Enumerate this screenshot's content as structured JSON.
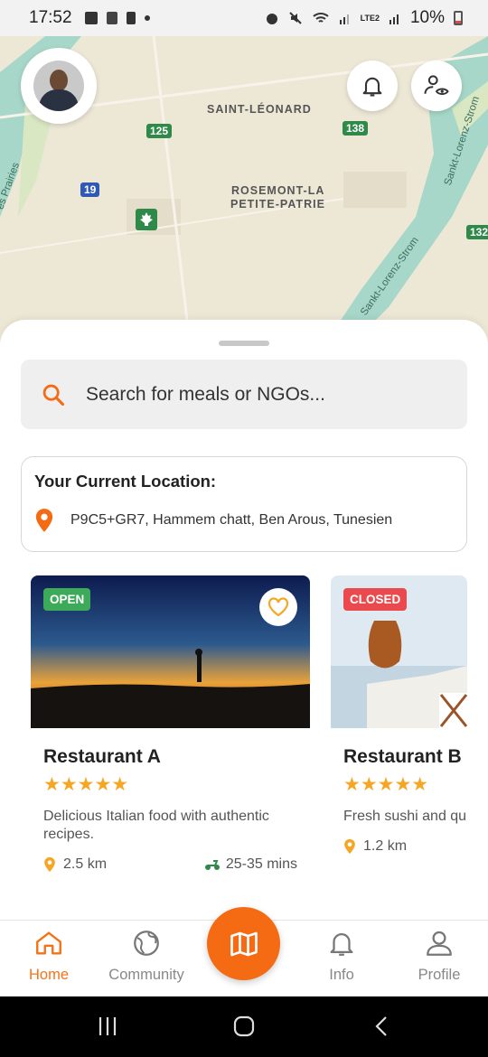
{
  "status_bar": {
    "time": "17:52",
    "battery": "10%",
    "network": "LTE2"
  },
  "map": {
    "labels": [
      "SAINT-LÉONARD",
      "ROSEMONT-LA",
      "PETITE-PATRIE"
    ],
    "shields": [
      "125",
      "138",
      "19",
      "132"
    ],
    "rivers": [
      "Sankt-Lorenz-Strom",
      "Sankt-Lorenz-Strom",
      "es Prairies"
    ],
    "colors": {
      "land": "#ede7d6",
      "water": "#a7d7c8",
      "park": "#d9e7c3"
    }
  },
  "header": {
    "avatar_icon": "user-avatar",
    "notification_icon": "bell-icon",
    "visibility_icon": "user-eye-icon"
  },
  "search": {
    "placeholder": "Search for meals or NGOs...",
    "icon": "search-icon"
  },
  "location": {
    "title": "Your Current Location:",
    "address": "P9C5+GR7, Hammem chatt, Ben Arous, Tunesien",
    "icon": "map-pin-icon"
  },
  "restaurants": [
    {
      "status": "OPEN",
      "name": "Restaurant A",
      "rating": 5,
      "stars": "★★★★★",
      "description": "Delicious Italian food with authentic recipes.",
      "distance": "2.5 km",
      "delivery_time": "25-35 mins"
    },
    {
      "status": "CLOSED",
      "name": "Restaurant B",
      "rating": 5,
      "stars": "★★★★★",
      "description": "Fresh sushi and qu",
      "distance": "1.2 km"
    }
  ],
  "nav": {
    "items": [
      {
        "label": "Home",
        "icon": "home-icon",
        "active": true
      },
      {
        "label": "Community",
        "icon": "globe-icon",
        "active": false
      },
      {
        "label": "",
        "icon": "map-icon",
        "active": false
      },
      {
        "label": "Info",
        "icon": "bell-icon",
        "active": false
      },
      {
        "label": "Profile",
        "icon": "user-icon",
        "active": false
      }
    ]
  },
  "theme": {
    "accent": "#f46b14",
    "open": "#3daa5a",
    "closed": "#ea4a4d",
    "star": "#f5a623"
  }
}
